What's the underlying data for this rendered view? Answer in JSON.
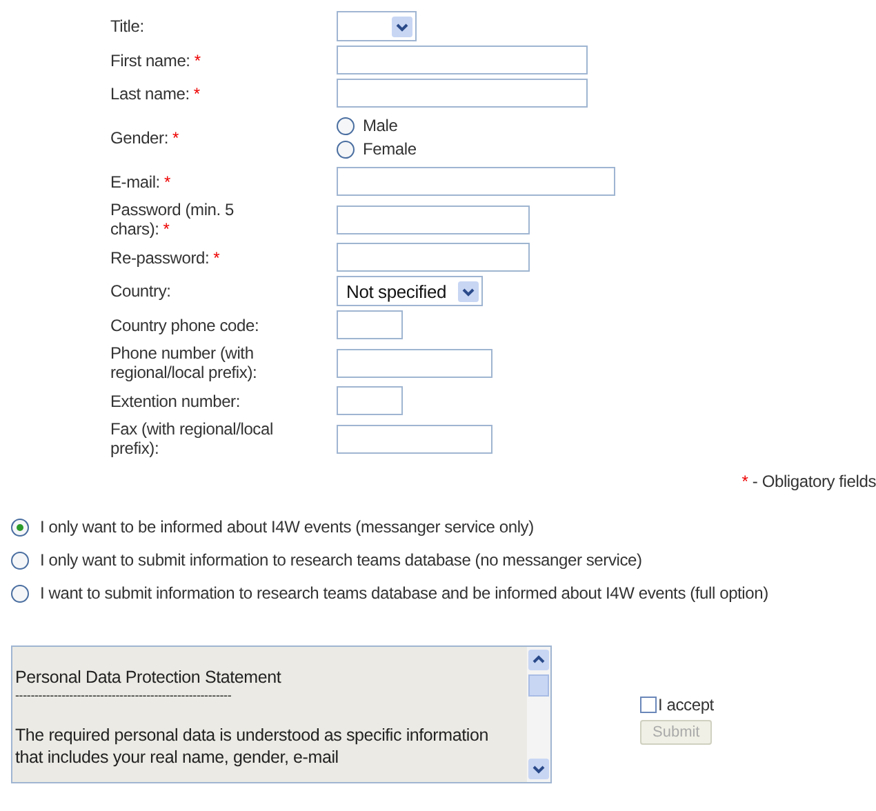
{
  "form": {
    "fields": [
      {
        "kind": "select",
        "label": "Title:",
        "required": false
      },
      {
        "kind": "text",
        "label": "First name:",
        "required": true
      },
      {
        "kind": "text",
        "label": "Last name:",
        "required": true
      },
      {
        "kind": "radio",
        "label": "Gender:",
        "required": true,
        "options": [
          {
            "label": "Male",
            "selected": false
          },
          {
            "label": "Female",
            "selected": false
          }
        ]
      },
      {
        "kind": "text",
        "label": "E-mail:",
        "required": true
      },
      {
        "kind": "text",
        "label": "Password (min. 5 chars):",
        "required": true
      },
      {
        "kind": "text",
        "label": "Re-password:",
        "required": true
      },
      {
        "kind": "select",
        "label": "Country:",
        "required": false,
        "value": "Not specified"
      },
      {
        "kind": "text",
        "label": "Country phone code:",
        "required": false
      },
      {
        "kind": "text",
        "label": "Phone number (with regional/local prefix):",
        "required": false
      },
      {
        "kind": "text",
        "label": "Extention number:",
        "required": false
      },
      {
        "kind": "text",
        "label": "Fax (with regional/local prefix):",
        "required": false
      }
    ],
    "required_mark": "*",
    "required_note": "- Obligatory fields"
  },
  "options": [
    {
      "label": "I only want to be informed about I4W events (messanger service only)",
      "selected": true
    },
    {
      "label": "I only want to submit information to research teams database (no messanger service)",
      "selected": false
    },
    {
      "label": "I want to submit information to research teams database and be informed about I4W events (full option)",
      "selected": false
    }
  ],
  "statement": {
    "title": "Personal Data Protection Statement",
    "rule": "--------------------------------------------------------",
    "text": "The required personal data is understood as specific information that includes your real name, gender, e-mail"
  },
  "accept": {
    "label": "I accept",
    "checked": false
  },
  "submit": {
    "label": "Submit",
    "disabled": true
  }
}
